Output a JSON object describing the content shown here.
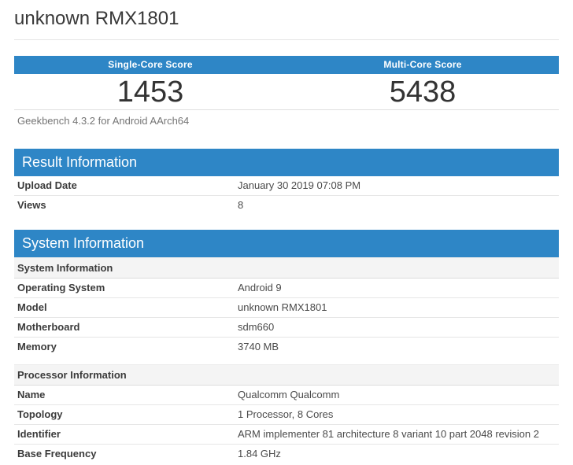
{
  "page": {
    "title": "unknown RMX1801"
  },
  "colors": {
    "accent_blue": "#2e86c6",
    "score_text": "#333333",
    "border_light": "#e6e6e6",
    "subheader_bg": "#f4f4f4"
  },
  "scores": {
    "columns": [
      {
        "label": "Single-Core Score",
        "value": "1453"
      },
      {
        "label": "Multi-Core Score",
        "value": "5438"
      }
    ],
    "footer": "Geekbench 4.3.2 for Android AArch64"
  },
  "result_information": {
    "title": "Result Information",
    "rows": [
      {
        "label": "Upload Date",
        "value": "January 30 2019 07:08 PM"
      },
      {
        "label": "Views",
        "value": "8"
      }
    ]
  },
  "system_information": {
    "title": "System Information",
    "groups": [
      {
        "header": "System Information",
        "rows": [
          {
            "label": "Operating System",
            "value": "Android 9"
          },
          {
            "label": "Model",
            "value": "unknown RMX1801"
          },
          {
            "label": "Motherboard",
            "value": "sdm660"
          },
          {
            "label": "Memory",
            "value": "3740 MB"
          }
        ]
      },
      {
        "header": "Processor Information",
        "rows": [
          {
            "label": "Name",
            "value": "Qualcomm Qualcomm"
          },
          {
            "label": "Topology",
            "value": "1 Processor, 8 Cores"
          },
          {
            "label": "Identifier",
            "value": "ARM implementer 81 architecture 8 variant 10 part 2048 revision 2"
          },
          {
            "label": "Base Frequency",
            "value": "1.84 GHz"
          }
        ]
      }
    ]
  }
}
